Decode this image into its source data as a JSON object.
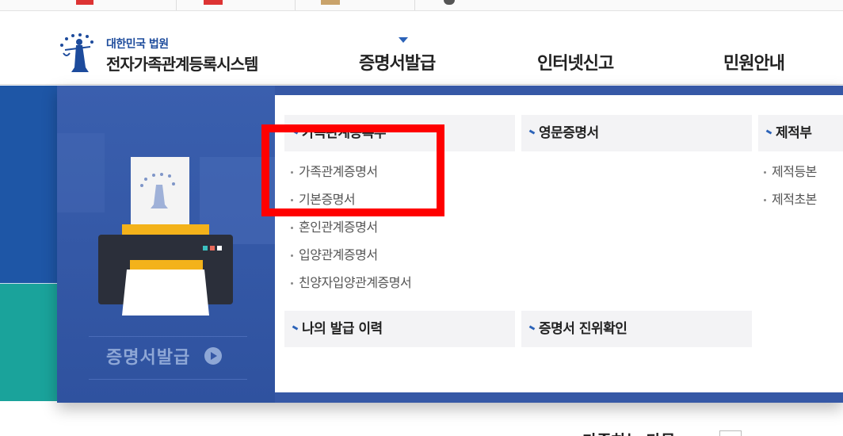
{
  "header": {
    "logo_sub": "대한민국 법원",
    "logo_main": "전자가족관계등록시스템",
    "nav": [
      "증명서발급",
      "인터넷신고",
      "민원안내"
    ]
  },
  "promo": {
    "label": "증명서발급"
  },
  "menu": {
    "family": {
      "title": "가족관계등록부",
      "items": [
        "가족관계증명서",
        "기본증명서",
        "혼인관계증명서",
        "입양관계증명서",
        "친양자입양관계증명서"
      ]
    },
    "english": {
      "title": "영문증명서"
    },
    "jejeok": {
      "title": "제적부",
      "items": [
        "제적등본",
        "제적초본"
      ]
    },
    "history": {
      "title": "나의 발급 이력"
    },
    "verify": {
      "title": "증명서 진위확인"
    }
  },
  "bottom": {
    "text": "가족하는 다물"
  },
  "colors": {
    "accent": "#2b62b8",
    "highlight": "#ff0000",
    "promo_bg": "#3658a6",
    "teal": "#1aa39b"
  }
}
